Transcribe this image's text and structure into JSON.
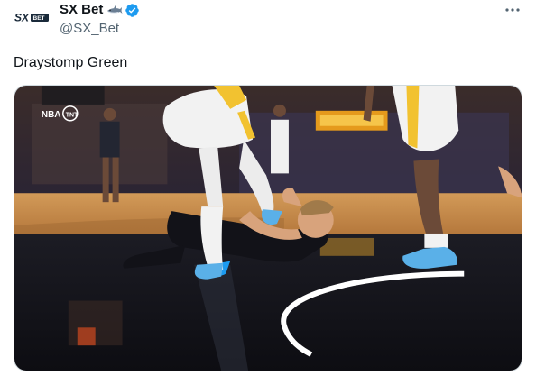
{
  "author": {
    "display_name": "SX Bet",
    "handle": "@SX_Bet",
    "avatar_logo_text": "SX BET",
    "icons": [
      "shark-emoji-icon",
      "verified-badge-icon"
    ]
  },
  "menu": {
    "icon": "more-options-icon"
  },
  "tweet": {
    "text": "Draystomp Green"
  },
  "media": {
    "type": "video-still",
    "overlays": {
      "network_logo_text": "NBA TNT",
      "arena_sign_text": ""
    }
  },
  "colors": {
    "handle": "#536471",
    "verified": "#1d9bf0",
    "court_wood": "#c98a46",
    "court_dark": "#14141a",
    "jersey_gold": "#f2c230"
  }
}
